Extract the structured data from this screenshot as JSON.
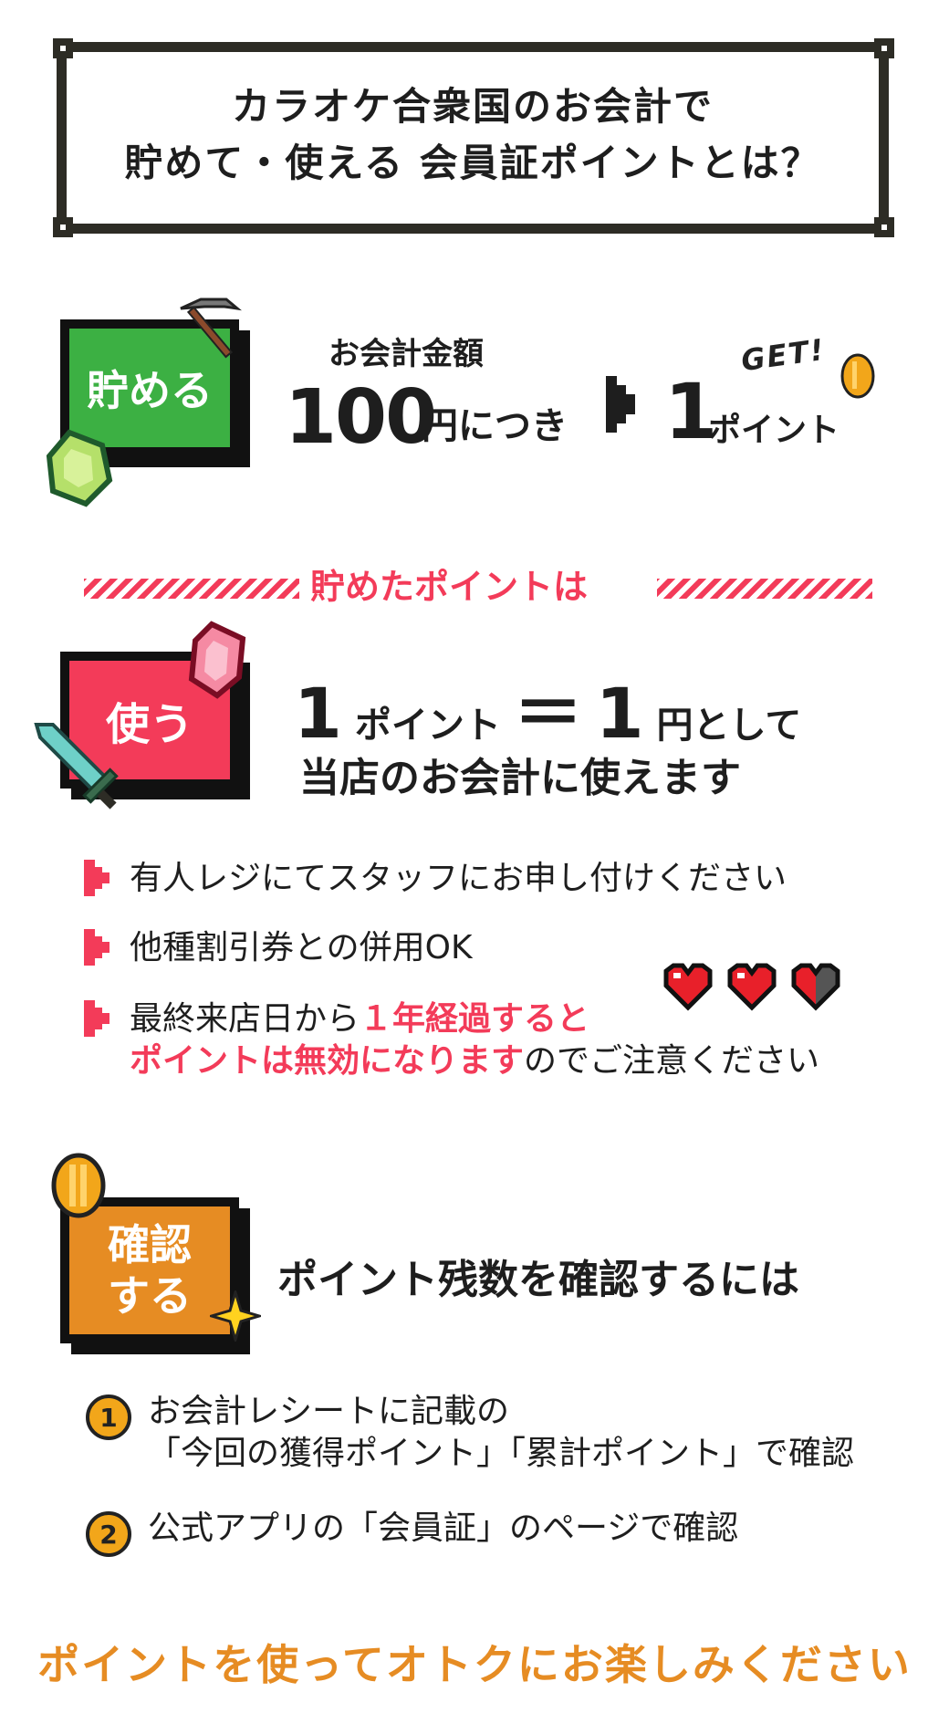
{
  "title": {
    "line1": "カラオケ合衆国のお会計で",
    "line2": "貯めて・使える 会員証ポイントとは？"
  },
  "earn": {
    "badge": "貯める",
    "caption": "お会計金額",
    "amount": "100",
    "amount_unit": "円につき",
    "points": "1",
    "points_unit": "ポイント",
    "get_label": "GET!"
  },
  "divider": {
    "text": "貯めたポイントは"
  },
  "use": {
    "badge": "使う",
    "rate_points": "1",
    "rate_points_unit": "ポイント",
    "equals": "＝",
    "rate_yen": "1",
    "rate_yen_unit": "円として",
    "line2": "当店のお会計に使えます"
  },
  "notes": [
    {
      "text": "有人レジにてスタッフにお申し付けください"
    },
    {
      "text": "他種割引券との併用OK"
    },
    {
      "text_before": "最終来店日から",
      "highlight1": "１年経過すると",
      "highlight2": "ポイントは無効になります",
      "text_after": "のでご注意ください"
    }
  ],
  "check": {
    "badge": "確認する",
    "badge_line1": "確認",
    "badge_line2": "する",
    "heading": "ポイント残数を確認するには",
    "steps": [
      {
        "num": "1",
        "line1": "お会計レシートに記載の",
        "line2": "「今回の獲得ポイント」「累計ポイント」で確認"
      },
      {
        "num": "2",
        "line1": "公式アプリの「会員証」のページで確認"
      }
    ]
  },
  "footer": {
    "text": "ポイントを使ってオトクにお楽しみください"
  },
  "colors": {
    "green": "#3cb043",
    "pink": "#f33b59",
    "orange": "#e68c23",
    "dark": "#2d2c25"
  },
  "icons": [
    "pickaxe-icon",
    "green-gem-icon",
    "coin-icon",
    "arrow-icon",
    "red-gem-icon",
    "sword-icon",
    "heart-icon",
    "coin-icon",
    "sparkle-icon"
  ]
}
